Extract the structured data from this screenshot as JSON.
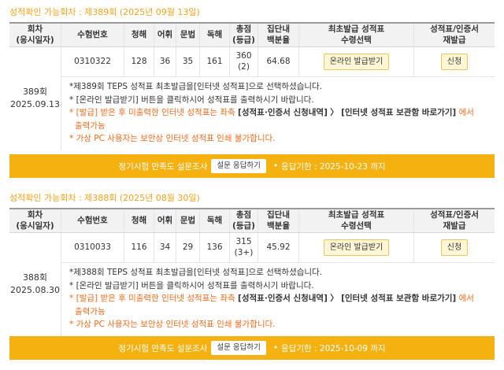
{
  "headers": {
    "round": [
      "회차",
      "(응시일자)"
    ],
    "exam_no": "수험번호",
    "listening": "청해",
    "vocab": "어휘",
    "grammar": "문법",
    "reading": "독해",
    "total": [
      "총점",
      "(등급)"
    ],
    "percentile": [
      "집단내",
      "백분율"
    ],
    "issue": [
      "최초발급 성적표",
      "수령선택"
    ],
    "reissue": [
      "성적표/인증서",
      "재발급"
    ]
  },
  "sections": [
    {
      "title": "성적확인 가능회차 : 제389회 (2025년 09월 13일)",
      "round": "389회",
      "date": "2025.09.13",
      "exam_no": "0310322",
      "listening": "128",
      "vocab": "36",
      "grammar": "35",
      "reading": "161",
      "total": "360",
      "grade": "(2)",
      "percentile": "64.68",
      "issue_button": "온라인 발급받기",
      "reissue_button": "신청",
      "note1": "*제389회 TEPS 성적표 최초발급을[인터넷 성적표]으로 선택하셨습니다.",
      "note2": "* [온라인 발급받기] 버튼을 클릭하시어 성적표를 출력하시기 바랍니다.",
      "note3_star": "*",
      "note3_a": "[발급] 받은 후 미출력한 인터넷 성적표는 좌측",
      "note3_b": "[성적표·인증서 신청내역]",
      "note3_c": "〉",
      "note3_d": "[인터넷 성적표 보관함 바로가기]",
      "note3_e": "에서",
      "note3_f": "출력가능",
      "note4": "* 가상 PC 사용자는 보안상 인터넷 성적표 인쇄 불가합니다.",
      "survey_label": "정기시험 만족도 설문조사",
      "survey_button": "설문 응답하기",
      "survey_dot": "•",
      "survey_deadline": "응답기한 : 2025-10-23 까지"
    },
    {
      "title": "성적확인 가능회차 : 제388회 (2025년 08월 30일)",
      "round": "388회",
      "date": "2025.08.30",
      "exam_no": "0310033",
      "listening": "116",
      "vocab": "34",
      "grammar": "29",
      "reading": "136",
      "total": "315",
      "grade": "(3+)",
      "percentile": "45.92",
      "issue_button": "온라인 발급받기",
      "reissue_button": "신청",
      "note1": "*제388회 TEPS 성적표 최초발급을[인터넷 성적표]으로 선택하셨습니다.",
      "note2": "* [온라인 발급받기] 버튼을 클릭하시어 성적표를 출력하시기 바랍니다.",
      "note3_star": "*",
      "note3_a": "[발급] 받은 후 미출력한 인터넷 성적표는 좌측",
      "note3_b": "[성적표·인증서 신청내역]",
      "note3_c": "〉",
      "note3_d": "[인터넷 성적표 보관함 바로가기]",
      "note3_e": "에서",
      "note3_f": "출력가능",
      "note4": "* 가상 PC 사용자는 보안상 인터넷 성적표 인쇄 불가합니다.",
      "survey_label": "정기시험 만족도 설문조사",
      "survey_button": "설문 응답하기",
      "survey_dot": "•",
      "survey_deadline": "응답기한 : 2025-10-09 까지"
    }
  ]
}
